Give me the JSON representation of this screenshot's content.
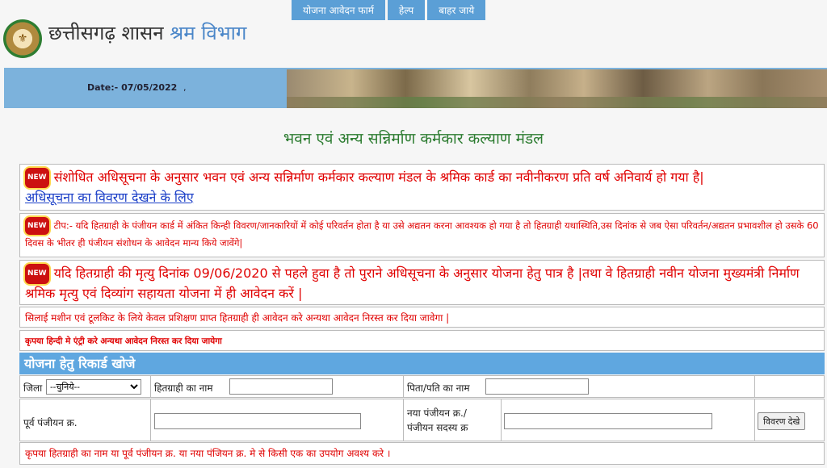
{
  "header": {
    "title_main": "छत्तीसगढ़ शासन",
    "title_dept": "श्रम विभाग",
    "logo_icon": "state-emblem"
  },
  "nav": [
    {
      "label": "योजना आवेदन फार्म"
    },
    {
      "label": "हेल्प"
    },
    {
      "label": "बाहर जाये"
    }
  ],
  "banner": {
    "date": "Date:- 07/05/2022",
    "comma": ","
  },
  "page_heading": "भवन एवं अन्य सन्निर्माण कर्मकार कल्याण मंडल",
  "notices": {
    "n1_badge": "NEW",
    "n1_text": "संशोधित अधिसूचना के अनुसार भवन एवं अन्य सन्निर्माण कर्मकार कल्याण मंडल के श्रमिक कार्ड का नवीनीकरण प्रति वर्ष अनिवार्य हो गया है|",
    "n1_link": "अधिसूचना का विवरण देखने के लिए",
    "n2_badge": "NEW",
    "n2_text": "टीप:- यदि हितग्राही के पंजीयन कार्ड में अंकित किन्ही विवरण/जानकारियों में कोई परिवर्तन होता है या उसे अद्यतन करना आवश्यक हो गया है तो हितग्राही यथास्थिति,उस दिनांक से जब ऐसा परिवर्तन/अद्यतन प्रभावशील हो उसके 60 दिवस के भीतर ही पंजीयन संशोधन के आवेदन मान्य किये जावेंगे|",
    "n3_badge": "NEW",
    "n3_text": "यदि हितग्राही की मृत्यु दिनांक 09/06/2020 से पहले हुवा है तो पुराने अधिसूचना के अनुसार योजना हेतु पात्र है |तथा वे हितग्राही नवीन योजना मुख्यमंत्री निर्माण श्रमिक मृत्यु एवं दिव्यांग सहायता योजना में ही आवेदन करें |",
    "n4_text": "सिलाई मशीन एवं टूलकिट के लिये केवल प्रशिक्षण प्राप्त हितग्राही ही आवेदन करे अन्यथा आवेदन निरस्त कर दिया जावेगा |",
    "n5_text": "कृपया हिन्दी मे एंट्री करे अन्यथा आवेदन निरस्त कर दिया जायेगा"
  },
  "search": {
    "heading": "योजना हेतु रिकार्ड खोजे",
    "district_label": "जिला",
    "district_selected": "--चुनिये--",
    "beneficiary_label": "हितग्राही का नाम",
    "beneficiary_value": "",
    "father_label": "पिता/पति का नाम",
    "father_value": "",
    "old_reg_label": "पूर्व पंजीयन क्र.",
    "old_reg_value": "",
    "new_reg_label_1": "नया पंजीयन क्र./",
    "new_reg_label_2": "पंजीयन सदस्य क्र",
    "new_reg_value": "",
    "view_button": "विवरण देखे",
    "footer_note": "कृपया हितग्राही का नाम या पूर्व पंजीयन क्र. या नया पंजियन क्र. मे से किसी एक का उपयोग अवश्य करे ।"
  },
  "colors": {
    "nav_bg": "#5b9fd6",
    "banner_bg": "#7cb2dc",
    "heading_green": "#2e7d32",
    "notice_red": "#e00000",
    "link_blue": "#1a3ec7"
  }
}
